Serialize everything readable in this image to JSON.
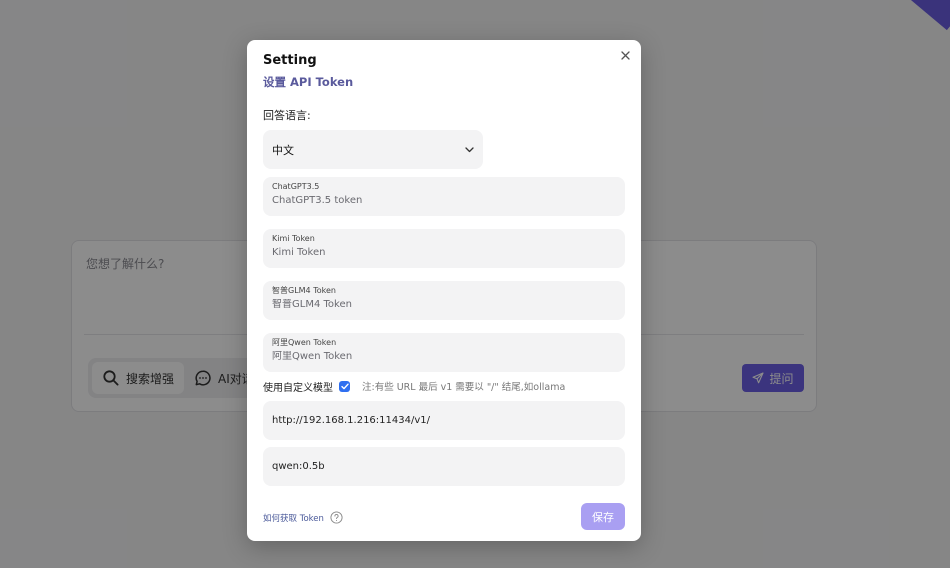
{
  "background": {
    "query_placeholder": "您想了解什么?",
    "modes": [
      {
        "label": "搜索增强",
        "icon": "search-icon"
      },
      {
        "label": "AI对话",
        "icon": "chat-bubble-icon"
      }
    ],
    "ask_label": "提问",
    "accent_color": "#6c60e6"
  },
  "modal": {
    "title": "Setting",
    "subtitle": "设置 API Token",
    "language_label": "回答语言:",
    "language_value": "中文",
    "tokens": [
      {
        "label": "ChatGPT3.5",
        "placeholder": "ChatGPT3.5 token"
      },
      {
        "label": "Kimi Token",
        "placeholder": "Kimi Token"
      },
      {
        "label": "智普GLM4 Token",
        "placeholder": "智普GLM4 Token"
      },
      {
        "label": "阿里Qwen Token",
        "placeholder": "阿里Qwen Token"
      }
    ],
    "custom_model_label": "使用自定义模型",
    "custom_model_checked": true,
    "custom_model_note": "注:有些 URL 最后 v1 需要以 \"/\" 结尾,如ollama",
    "custom_url_value": "http://192.168.1.216:11434/v1/",
    "custom_model_value": "qwen:0.5b",
    "how_to_get_token": "如何获取 Token",
    "save_label": "保存",
    "save_color": "#a99ff2"
  }
}
